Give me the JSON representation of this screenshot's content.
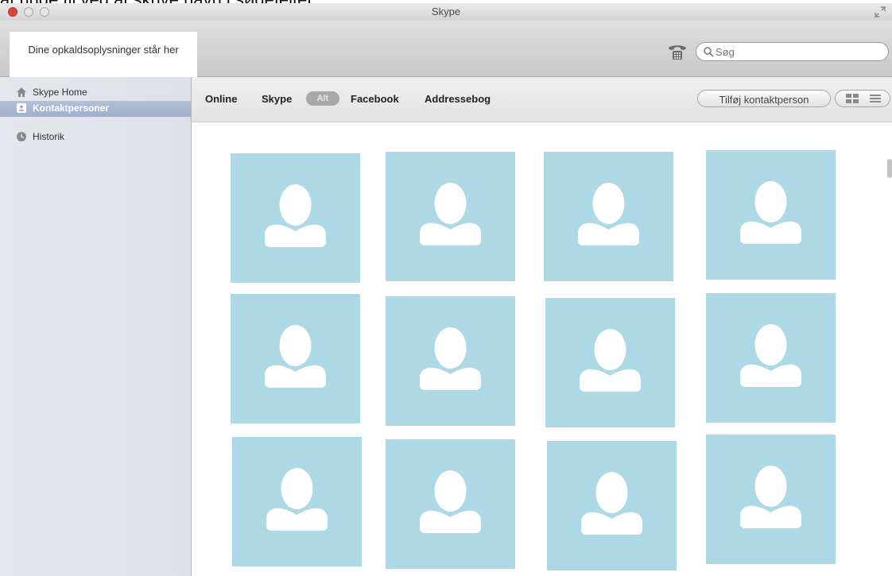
{
  "caption": "at ringe til ved at skrive navn i søgefeltet",
  "window": {
    "title": "Skype"
  },
  "toolbar": {
    "info_text": "Dine opkaldsoplysninger står her",
    "search_placeholder": "Søg"
  },
  "sidebar": {
    "items": [
      {
        "label": "Skype Home",
        "icon": "home-icon",
        "selected": false
      },
      {
        "label": "Kontaktpersoner",
        "icon": "contacts-icon",
        "selected": true
      },
      {
        "label": "Historik",
        "icon": "clock-icon",
        "selected": false
      }
    ]
  },
  "filters": {
    "online": "Online",
    "skype": "Skype",
    "all": "Alt",
    "facebook": "Facebook",
    "addressbook": "Addressebog"
  },
  "actions": {
    "add_contact": "Tilføj kontaktperson"
  },
  "contacts": {
    "count": 12,
    "tile_color": "#add8e6",
    "avatar": "default-avatar-icon"
  },
  "colors": {
    "tile": "#add8e6",
    "selected_sidebar": "#a9b8d3"
  }
}
